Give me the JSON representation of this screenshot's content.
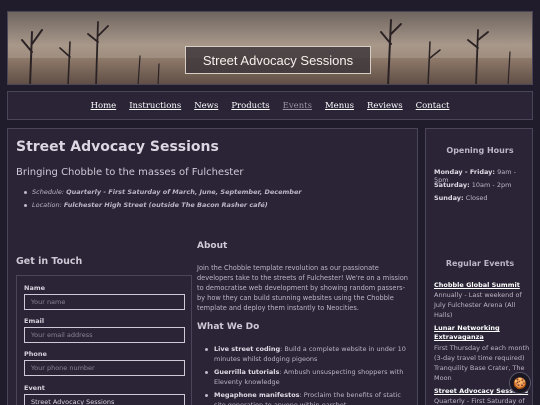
{
  "hero": {
    "title": "Street Advocacy Sessions"
  },
  "nav": {
    "items": [
      {
        "label": "Home"
      },
      {
        "label": "Instructions"
      },
      {
        "label": "News"
      },
      {
        "label": "Products"
      },
      {
        "label": "Events"
      },
      {
        "label": "Menus"
      },
      {
        "label": "Reviews"
      },
      {
        "label": "Contact"
      }
    ],
    "active": "Events"
  },
  "event": {
    "title": "Street Advocacy Sessions",
    "tagline": "Bringing Chobble to the masses of Fulchester",
    "schedule_label": "Schedule:",
    "schedule_value": "Quarterly - First Saturday of March, June, September, December",
    "location_label": "Location:",
    "location_value": "Fulchester High Street (outside The Bacon Rasher café)"
  },
  "contact": {
    "heading": "Get in Touch",
    "name_label": "Name",
    "name_placeholder": "Your name",
    "email_label": "Email",
    "email_placeholder": "Your email address",
    "phone_label": "Phone",
    "phone_placeholder": "Your phone number",
    "event_label": "Event",
    "event_value": "Street Advocacy Sessions"
  },
  "about": {
    "heading": "About",
    "body": "Join the Chobble template revolution as our passionate developers take to the streets of Fulchester! We're on a mission to democratise web development by showing random passers-by how they can build stunning websites using the Chobble template and deploy them instantly to Neocities."
  },
  "what_we_do": {
    "heading": "What We Do",
    "items": [
      {
        "title": "Live street coding",
        "text": ": Build a complete website in under 10 minutes whilst dodging pigeons"
      },
      {
        "title": "Guerrilla tutorials",
        "text": ": Ambush unsuspecting shoppers with Eleventy knowledge"
      },
      {
        "title": "Megaphone manifestos",
        "text": ": Proclaim the benefits of static site generation to anyone within earshot"
      }
    ]
  },
  "sidebar": {
    "hours_heading": "Opening Hours",
    "hours": [
      {
        "day": "Monday - Friday:",
        "time": "9am - 5pm"
      },
      {
        "day": "Saturday:",
        "time": "10am - 2pm"
      },
      {
        "day": "Sunday:",
        "time": "Closed"
      }
    ],
    "events_heading": "Regular Events",
    "events": [
      {
        "name": "Chobble Global Summit",
        "desc": "Annually - Last weekend of July Fulchester Arena (All Halls)"
      },
      {
        "name": "Lunar Networking Extravaganza",
        "desc": "First Thursday of each month (3-day travel time required) Tranquility Base Crater, The Moon"
      },
      {
        "name": "Street Advocacy Sessions",
        "desc": "Quarterly - First Saturday of"
      }
    ]
  },
  "colors": {
    "background": "#211c2b",
    "panel": "#2a2436",
    "border": "#4a4558",
    "text": "#cfc8d6"
  },
  "icons": {
    "cookie": "cookie-icon"
  }
}
